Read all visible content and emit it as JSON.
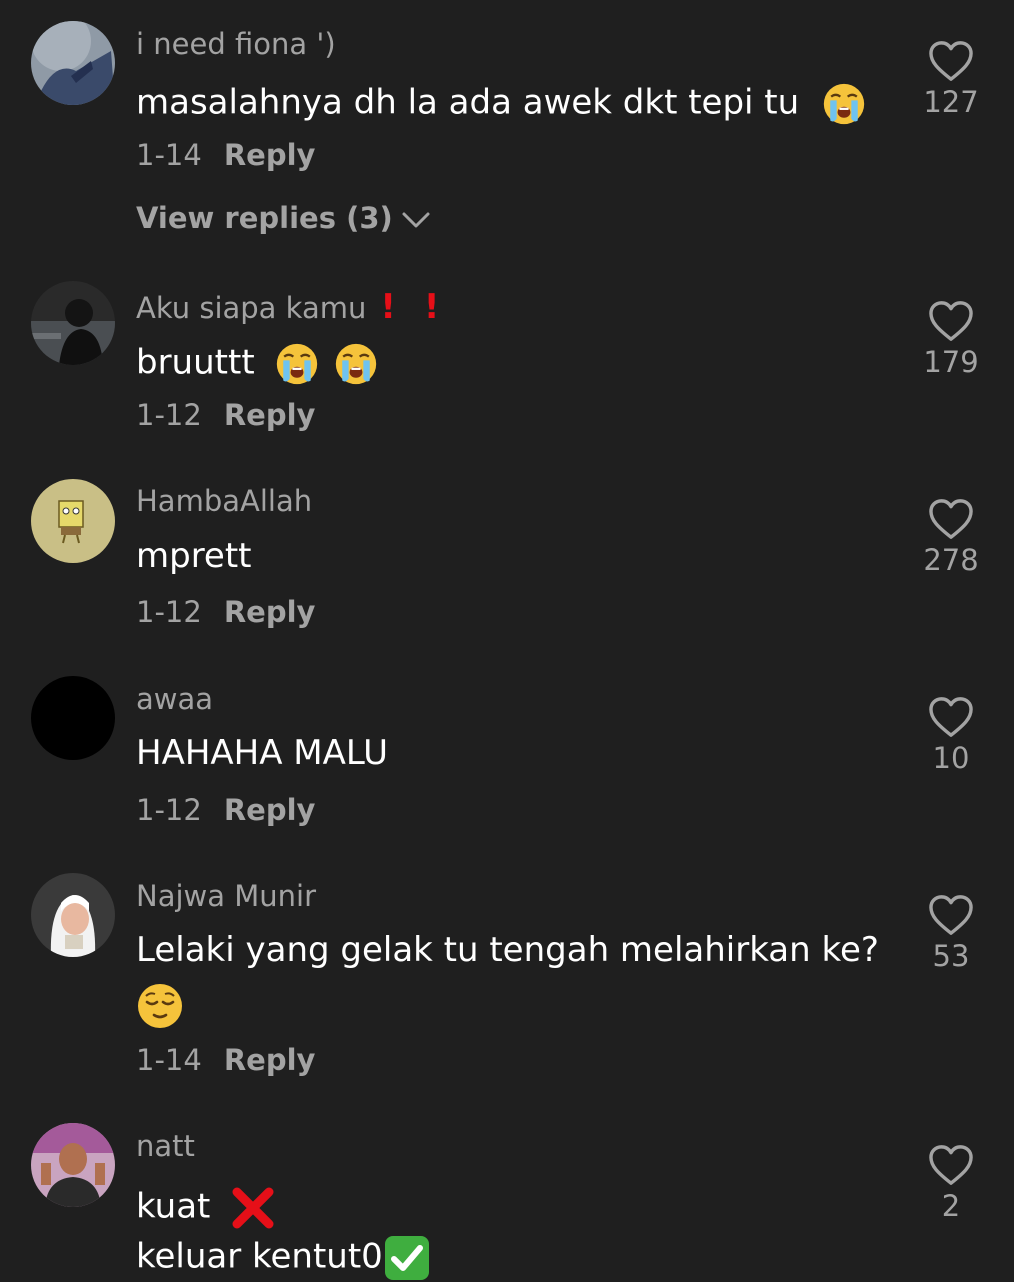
{
  "comments": [
    {
      "username": "i need fiona ')",
      "text": "masalahnya dh la ada awek dkt tepi tu",
      "text_emoji": "loudly-crying-face",
      "date": "1-14",
      "reply_label": "Reply",
      "view_replies": "View replies (3)",
      "likes": "127"
    },
    {
      "username": "Aku siapa kamu",
      "username_suffix": "❗ ❗",
      "text": "bruuttt",
      "text_emoji": "loudly-crying-face x2",
      "date": "1-12",
      "reply_label": "Reply",
      "likes": "179"
    },
    {
      "username": "HambaAllah",
      "text": "mprett",
      "date": "1-12",
      "reply_label": "Reply",
      "likes": "278"
    },
    {
      "username": "awaa",
      "text": "HAHAHA MALU",
      "date": "1-12",
      "reply_label": "Reply",
      "likes": "10"
    },
    {
      "username": "Najwa Munir",
      "text": "Lelaki yang gelak tu tengah melahirkan ke?",
      "text_emoji": "relieved-face",
      "date": "1-14",
      "reply_label": "Reply",
      "likes": "53"
    },
    {
      "username": "natt",
      "text_line1": "kuat",
      "text_line1_emoji": "cross-mark",
      "text_line2": "keluar kentut0",
      "text_line2_emoji": "check-mark-button",
      "likes": "2"
    }
  ],
  "colors": {
    "background": "#1f1f1f",
    "text_primary": "#ffffff",
    "text_secondary": "#a3a3a3",
    "exclamation": "#e60f18",
    "cross_mark": "#e60f18",
    "check_mark_bg": "#3fae3f"
  },
  "icons": {
    "like": "heart-outline-icon",
    "expand": "chevron-down-icon"
  }
}
